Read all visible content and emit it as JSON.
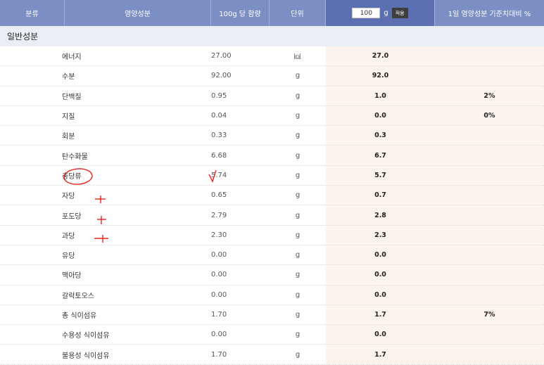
{
  "header": {
    "category": "분류",
    "nutrient": "영양성분",
    "per100g": "100g 당 함량",
    "unit": "단위",
    "amount_value": "100",
    "amount_unit": "g",
    "apply_label": "적용",
    "daily_value": "1일 영양성분 기준치대비 %"
  },
  "section": {
    "title": "일반성분"
  },
  "rows": [
    {
      "name": "에너지",
      "value": "27.00",
      "unit": "㎉",
      "amount": "27.0",
      "dv": ""
    },
    {
      "name": "수분",
      "value": "92.00",
      "unit": "g",
      "amount": "92.0",
      "dv": ""
    },
    {
      "name": "단백질",
      "value": "0.95",
      "unit": "g",
      "amount": "1.0",
      "dv": "2%"
    },
    {
      "name": "지질",
      "value": "0.04",
      "unit": "g",
      "amount": "0.0",
      "dv": "0%"
    },
    {
      "name": "회분",
      "value": "0.33",
      "unit": "g",
      "amount": "0.3",
      "dv": ""
    },
    {
      "name": "탄수화물",
      "value": "6.68",
      "unit": "g",
      "amount": "6.7",
      "dv": ""
    },
    {
      "name": "총당류",
      "value": "5.74",
      "unit": "g",
      "amount": "5.7",
      "dv": ""
    },
    {
      "name": "자당",
      "value": "0.65",
      "unit": "g",
      "amount": "0.7",
      "dv": ""
    },
    {
      "name": "포도당",
      "value": "2.79",
      "unit": "g",
      "amount": "2.8",
      "dv": ""
    },
    {
      "name": "과당",
      "value": "2.30",
      "unit": "g",
      "amount": "2.3",
      "dv": ""
    },
    {
      "name": "유당",
      "value": "0.00",
      "unit": "g",
      "amount": "0.0",
      "dv": ""
    },
    {
      "name": "맥아당",
      "value": "0.00",
      "unit": "g",
      "amount": "0.0",
      "dv": ""
    },
    {
      "name": "갈락토오스",
      "value": "0.00",
      "unit": "g",
      "amount": "0.0",
      "dv": ""
    },
    {
      "name": "총 식이섬유",
      "value": "1.70",
      "unit": "g",
      "amount": "1.7",
      "dv": "7%"
    },
    {
      "name": "수용성 식이섬유",
      "value": "0.00",
      "unit": "g",
      "amount": "0.0",
      "dv": ""
    },
    {
      "name": "불용성 식이섬유",
      "value": "1.70",
      "unit": "g",
      "amount": "1.7",
      "dv": ""
    }
  ],
  "colors": {
    "header_bg": "#7c8fc4",
    "amount_header_bg": "#5c6fb0",
    "section_bg": "#eceef5",
    "highlight_bg": "#fdf3ed",
    "annotation": "#e8231f"
  }
}
